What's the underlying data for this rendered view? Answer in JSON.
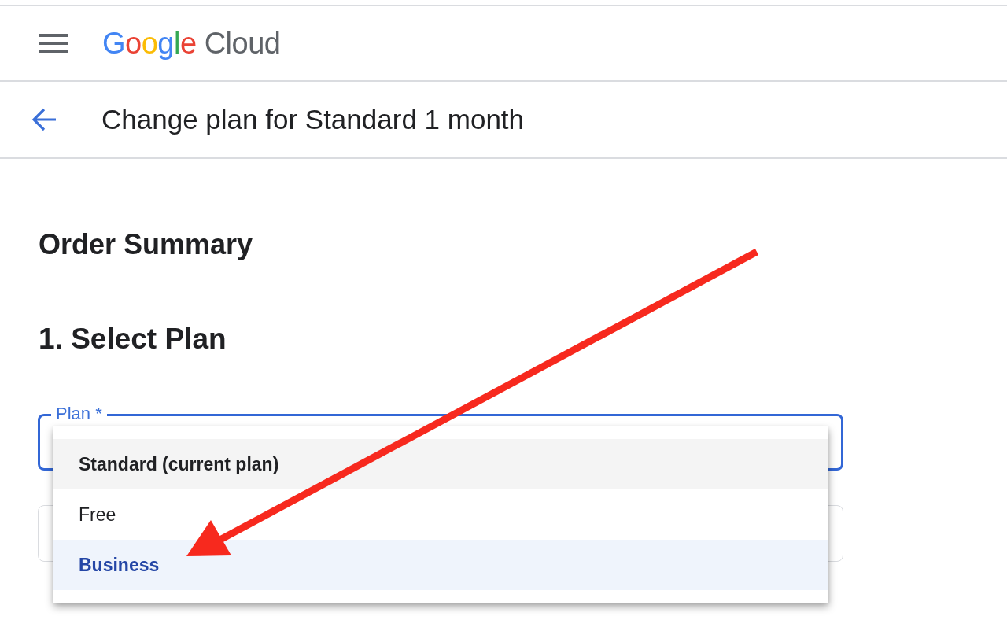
{
  "header": {
    "logo": {
      "brand": "Google",
      "product": "Cloud"
    }
  },
  "subheader": {
    "title": "Change plan for Standard 1 month"
  },
  "section_title": "Order Summary",
  "step_title": "1. Select Plan",
  "fields": [
    {
      "label": "Plan *",
      "focused": true,
      "open": true,
      "menu": {
        "items": [
          {
            "label": "Standard (current plan)",
            "highlighted": true,
            "selected": false
          },
          {
            "label": "Free",
            "highlighted": false,
            "selected": false
          },
          {
            "label": "Business",
            "highlighted": false,
            "selected": true
          }
        ]
      }
    },
    {
      "focused": false
    }
  ],
  "annotations": [
    {
      "kind": "arrow"
    }
  ]
}
